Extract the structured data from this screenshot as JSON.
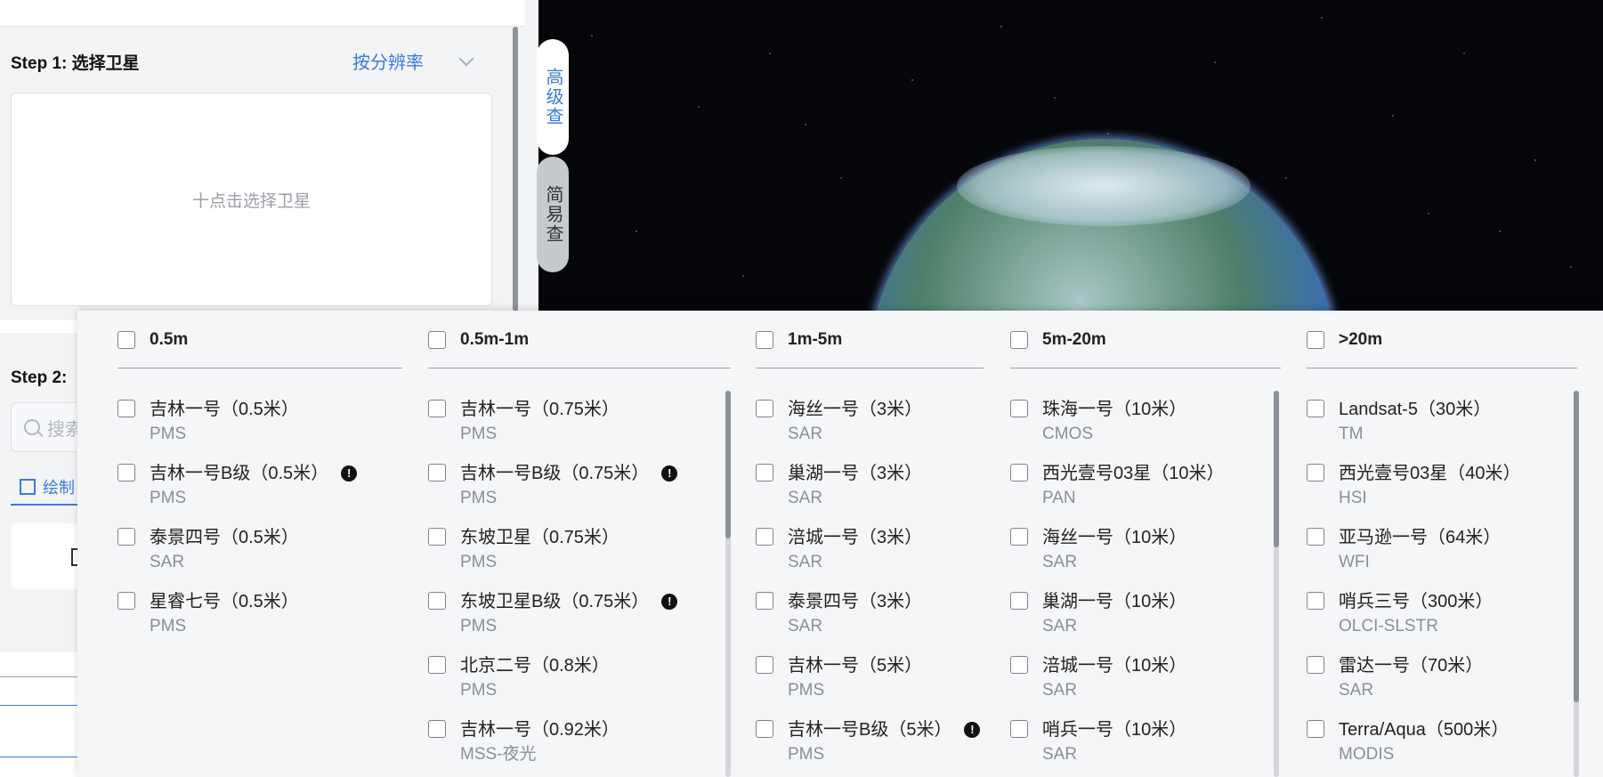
{
  "left_panel": {
    "step1_title": "Step 1: 选择卫星",
    "resolution_select": "按分辨率",
    "select_sat_placeholder": "十点击选择卫星",
    "step2_title": "Step 2:",
    "search_placeholder": "搜索",
    "draw_tab": "绘制"
  },
  "side_tabs": {
    "advanced": "高级查",
    "simple": "简易查"
  },
  "dropdown": {
    "columns": [
      {
        "header": "0.5m",
        "items": [
          {
            "name": "吉林一号（0.5米）",
            "sub": "PMS",
            "info": false
          },
          {
            "name": "吉林一号B级（0.5米）",
            "sub": "PMS",
            "info": true
          },
          {
            "name": "泰景四号（0.5米）",
            "sub": "SAR",
            "info": false
          },
          {
            "name": "星睿七号（0.5米）",
            "sub": "PMS",
            "info": false
          }
        ]
      },
      {
        "header": "0.5m-1m",
        "items": [
          {
            "name": "吉林一号（0.75米）",
            "sub": "PMS",
            "info": false
          },
          {
            "name": "吉林一号B级（0.75米）",
            "sub": "PMS",
            "info": true
          },
          {
            "name": "东坡卫星（0.75米）",
            "sub": "PMS",
            "info": false
          },
          {
            "name": "东坡卫星B级（0.75米）",
            "sub": "PMS",
            "info": true
          },
          {
            "name": "北京二号（0.8米）",
            "sub": "PMS",
            "info": false
          },
          {
            "name": "吉林一号（0.92米）",
            "sub": "MSS-夜光",
            "info": false
          }
        ]
      },
      {
        "header": "1m-5m",
        "items": [
          {
            "name": "海丝一号（3米）",
            "sub": "SAR",
            "info": false
          },
          {
            "name": "巢湖一号（3米）",
            "sub": "SAR",
            "info": false
          },
          {
            "name": "涪城一号（3米）",
            "sub": "SAR",
            "info": false
          },
          {
            "name": "泰景四号（3米）",
            "sub": "SAR",
            "info": false
          },
          {
            "name": "吉林一号（5米）",
            "sub": "PMS",
            "info": false
          },
          {
            "name": "吉林一号B级（5米）",
            "sub": "PMS",
            "info": true
          }
        ]
      },
      {
        "header": "5m-20m",
        "items": [
          {
            "name": "珠海一号（10米）",
            "sub": "CMOS",
            "info": false
          },
          {
            "name": "西光壹号03星（10米）",
            "sub": "PAN",
            "info": false
          },
          {
            "name": "海丝一号（10米）",
            "sub": "SAR",
            "info": false
          },
          {
            "name": "巢湖一号（10米）",
            "sub": "SAR",
            "info": false
          },
          {
            "name": "涪城一号（10米）",
            "sub": "SAR",
            "info": false
          },
          {
            "name": "哨兵一号（10米）",
            "sub": "SAR",
            "info": false
          }
        ]
      },
      {
        "header": ">20m",
        "items": [
          {
            "name": "Landsat-5（30米）",
            "sub": "TM",
            "info": false
          },
          {
            "name": "西光壹号03星（40米）",
            "sub": "HSI",
            "info": false
          },
          {
            "name": "亚马逊一号（64米）",
            "sub": "WFI",
            "info": false
          },
          {
            "name": "哨兵三号（300米）",
            "sub": "OLCI-SLSTR",
            "info": false
          },
          {
            "name": "雷达一号（70米）",
            "sub": "SAR",
            "info": false
          },
          {
            "name": "Terra/Aqua（500米）",
            "sub": "MODIS",
            "info": false
          }
        ]
      }
    ]
  },
  "colors": {
    "accent": "#3a7bd5",
    "text": "#222222",
    "muted": "#8a8f96"
  }
}
